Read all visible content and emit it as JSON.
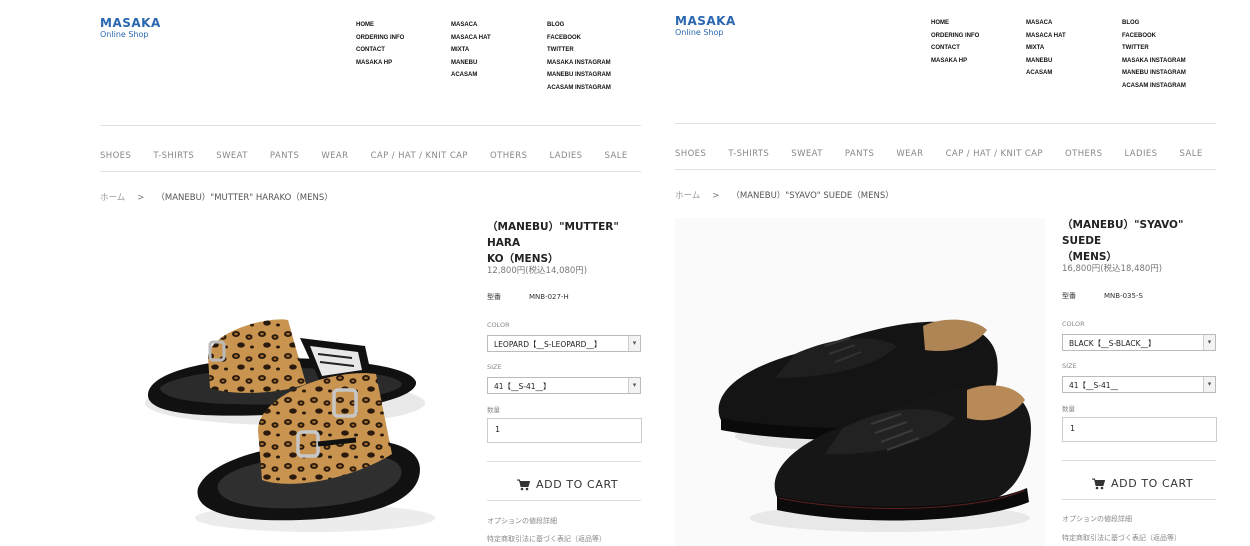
{
  "header": {
    "logo_name": "MASAKA",
    "logo_sub": "Online Shop",
    "nav_col1": [
      "HOME",
      "ORDERING INFO",
      "CONTACT",
      "MASAKA HP"
    ],
    "nav_col2": [
      "MASACA",
      "MASACA HAT",
      "MIXTA",
      "MANEBU",
      "ACASAM"
    ],
    "nav_col3": [
      "BLOG",
      "FACEBOOK",
      "TWITTER",
      "MASAKA INSTAGRAM",
      "MANEBU INSTAGRAM",
      "ACASAM INSTAGRAM"
    ]
  },
  "categories": [
    "SHOES",
    "T-SHIRTS",
    "SWEAT",
    "PANTS",
    "WEAR",
    "CAP / HAT / KNIT CAP",
    "OTHERS",
    "LADIES",
    "SALE"
  ],
  "breadcrumb": {
    "home": "ホーム",
    "separator": ">"
  },
  "labels": {
    "model_no": "型番",
    "color": "COLOR",
    "size": "SIZE",
    "quantity": "数量",
    "add_to_cart": "ADD TO CART",
    "option_price": "オプションの値段詳細",
    "commerce_law": "特定商取引法に基づく表記（返品等）"
  },
  "products": [
    {
      "breadcrumb_current": "（MANEBU）\"MUTTER\" HARAKO（MENS）",
      "title_line1": "（MANEBU）\"MUTTER\" HARA",
      "title_line2": "KO（MENS）",
      "price": "12,800円(税込14,080円)",
      "model": "MNB-027-H",
      "color_value": "LEOPARD【__S-LEOPARD__】",
      "size_value": "41【__S-41__】",
      "quantity": "1",
      "photo_icon": "leopard-slide-sandal"
    },
    {
      "breadcrumb_current": "（MANEBU）\"SYAVO\" SUEDE（MENS）",
      "title_line1": "（MANEBU）\"SYAVO\" SUEDE",
      "title_line2": "（MENS）",
      "price": "16,800円(税込18,480円)",
      "model": "MNB-035-S",
      "color_value": "BLACK【__S-BLACK__】",
      "size_value": "41【__S-41__",
      "quantity": "1",
      "photo_icon": "black-suede-shoe"
    }
  ],
  "colors": {
    "logo_blue": "#2a67b0",
    "divider": "#e1e1e1",
    "muted": "#888888"
  }
}
